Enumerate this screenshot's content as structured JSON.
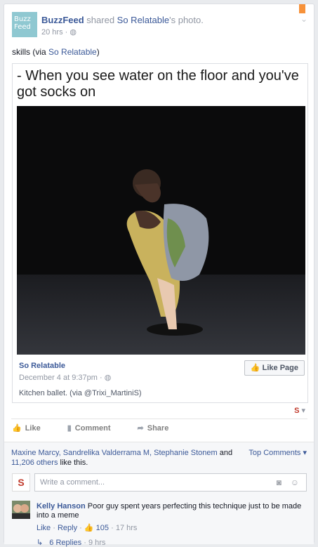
{
  "post": {
    "author_logo_line1": "Buzz",
    "author_logo_line2": "Feed",
    "author": "BuzzFeed",
    "shared_verb": "shared",
    "source": "So Relatable",
    "shared_suffix": "'s photo.",
    "time": "20 hrs",
    "caption_prefix": "skills (via ",
    "caption_link": "So Relatable",
    "caption_suffix": ")"
  },
  "shared_card": {
    "meme_text": "- When you see water on the floor and you've got socks on",
    "source_name": "So Relatable",
    "source_time": "December 4 at 9:37pm",
    "like_page_label": "Like Page",
    "description": "Kitchen ballet. (via @Trixi_MartiniS)"
  },
  "actions": {
    "like": "Like",
    "comment": "Comment",
    "share": "Share"
  },
  "ufi": {
    "likers_names": "Maxine Marcy, Sandrelika Valderrama M, Stephanie Stonem",
    "likers_and": "and",
    "likers_others": "11,206 others",
    "likers_suffix": "like this.",
    "top_comments": "Top Comments"
  },
  "composer": {
    "placeholder": "Write a comment..."
  },
  "comment": {
    "author": "Kelly Hanson",
    "text": "Poor guy spent years perfecting this technique just to be made into a meme",
    "like": "Like",
    "reply": "Reply",
    "like_count": "105",
    "time": "17 hrs",
    "replies_label": "6 Replies",
    "replies_time": "9 hrs"
  },
  "icons": [
    "bookmark-icon",
    "chevron-down-icon",
    "globe-icon",
    "thumbs-up-icon",
    "comment-icon",
    "share-icon",
    "camera-icon",
    "smile-icon",
    "reply-arrow-icon"
  ]
}
